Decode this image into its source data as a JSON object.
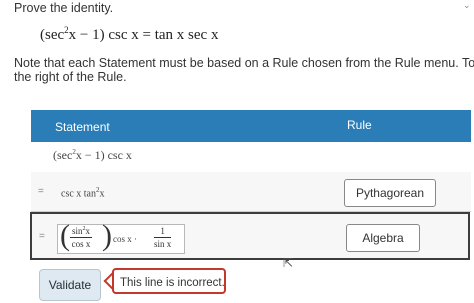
{
  "prompt": "Prove the identity.",
  "identity": {
    "lhs_a": "(sec",
    "lhs_exp": "2",
    "lhs_b": "x − 1) csc x = tan x sec x"
  },
  "note": {
    "line1": "Note that each Statement must be based on a Rule chosen from the Rule menu. To see a detaile",
    "line2": "the right of the Rule."
  },
  "table": {
    "header_statement": "Statement",
    "header_rule": "Rule",
    "rows": [
      {
        "statement_a": "(sec",
        "statement_exp": "2",
        "statement_b": "x − 1) csc x",
        "rule": ""
      },
      {
        "eq": "=",
        "statement_a": "csc x tan",
        "statement_exp": "2",
        "statement_b": "x",
        "rule": "Pythagorean"
      },
      {
        "eq": "=",
        "frac1_num": "sin",
        "frac1_num_exp": "2",
        "frac1_num_b": "x",
        "frac1_den": "cos x",
        "mid": "cos x ·",
        "frac2_num": "1",
        "frac2_den": "sin x",
        "rule": "Algebra"
      }
    ]
  },
  "validate_label": "Validate",
  "error_message": "This line is incorrect.",
  "colors": {
    "header_bg": "#2a7db7",
    "error_border": "#c0392b",
    "validate_bg": "#dfe9f2"
  }
}
